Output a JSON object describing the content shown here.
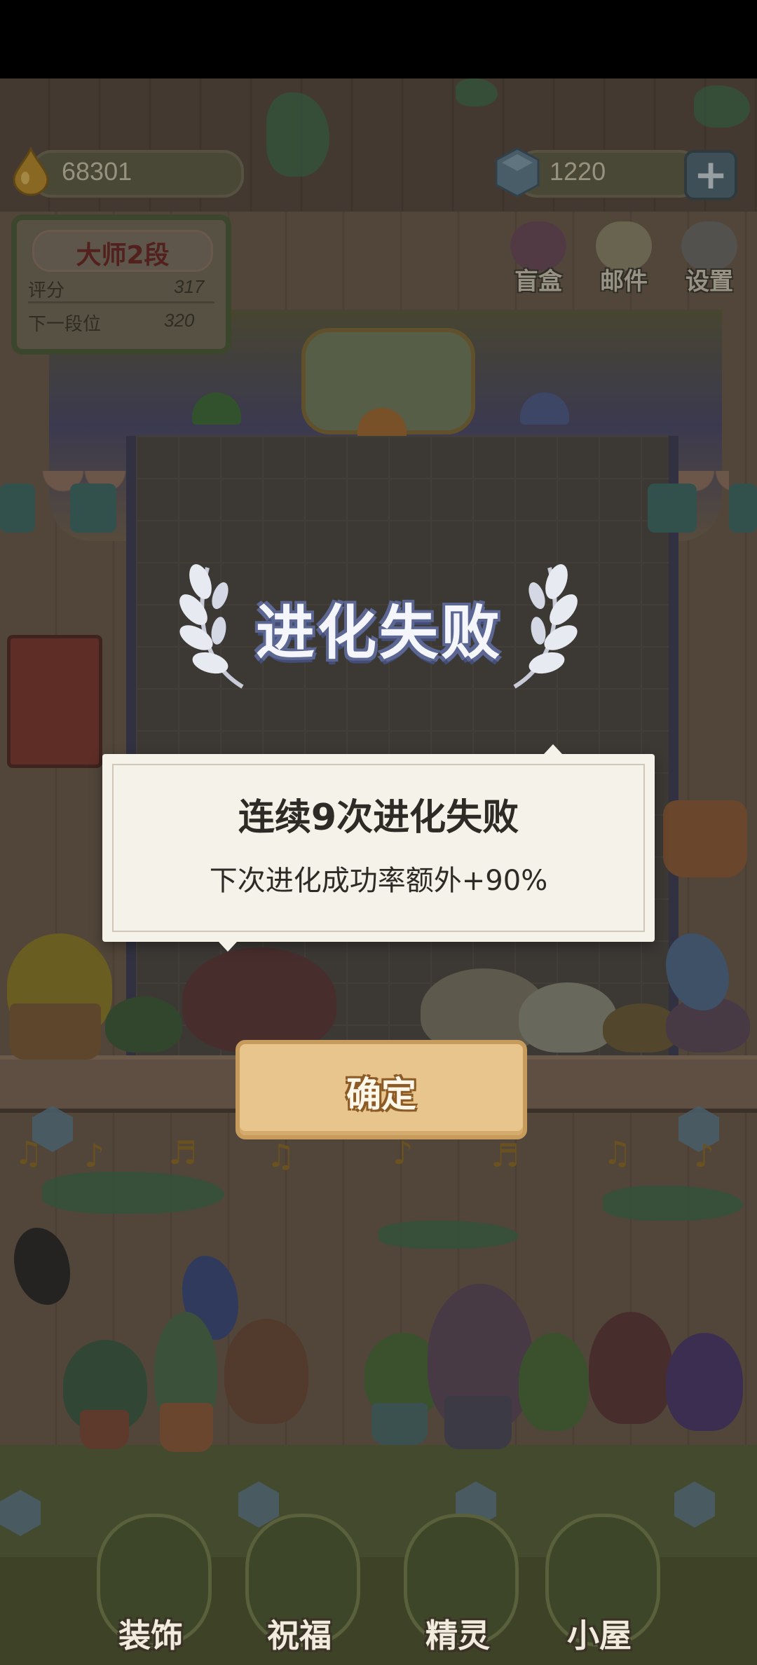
{
  "hud": {
    "drops_value": "68301",
    "gems_value": "1220"
  },
  "rank": {
    "title": "大师2段",
    "score_label": "评分",
    "score_value": "317",
    "next_label": "下一段位",
    "next_value": "320"
  },
  "menu": [
    {
      "label": "盲盒"
    },
    {
      "label": "邮件"
    },
    {
      "label": "设置"
    }
  ],
  "dialog": {
    "title": "进化失败",
    "message": "连续9次进化失败",
    "sub_message": "下次进化成功率额外+90%",
    "confirm_label": "确定"
  },
  "nav": [
    {
      "label": "装饰"
    },
    {
      "label": "祝福"
    },
    {
      "label": "精灵"
    },
    {
      "label": "小屋"
    }
  ],
  "colors": {
    "dialog_bg": "#f5f2e9",
    "confirm_bg": "#e8c58c",
    "title_outline": "#5b6693"
  }
}
